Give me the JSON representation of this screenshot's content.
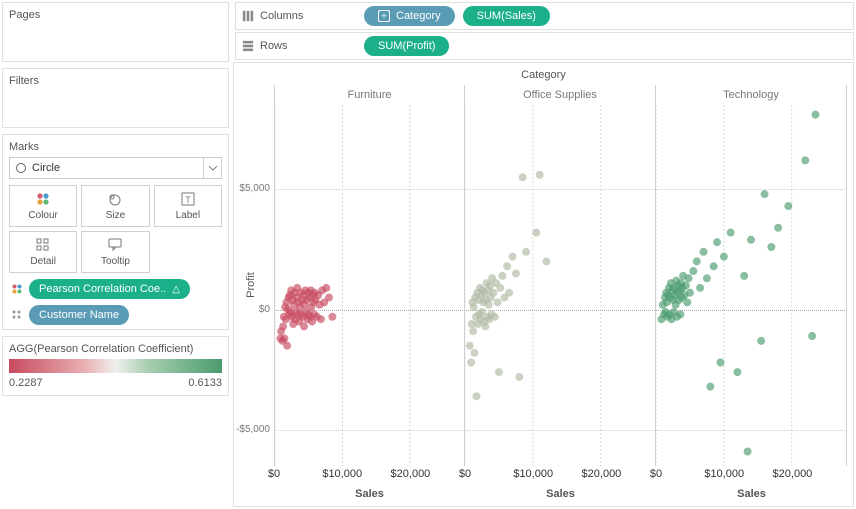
{
  "sidebar": {
    "pages_title": "Pages",
    "filters_title": "Filters",
    "marks_title": "Marks",
    "mark_type": "Circle",
    "cards": {
      "colour": "Colour",
      "size": "Size",
      "label": "Label",
      "detail": "Detail",
      "tooltip": "Tooltip"
    },
    "colour_pill": "Pearson Correlation Coe..",
    "detail_pill": "Customer Name"
  },
  "legend": {
    "title": "AGG(Pearson Correlation Coefficient)",
    "min": "0.2287",
    "max": "0.6133"
  },
  "shelves": {
    "columns_label": "Columns",
    "rows_label": "Rows",
    "columns": [
      {
        "label": "Category",
        "color": "blue",
        "plus": true
      },
      {
        "label": "SUM(Sales)",
        "color": "green",
        "plus": false
      }
    ],
    "rows": [
      {
        "label": "SUM(Profit)",
        "color": "green",
        "plus": false
      }
    ]
  },
  "chart_data": {
    "type": "scatter",
    "title": "Category",
    "xlabel": "Sales",
    "ylabel": "Profit",
    "facets": [
      "Furniture",
      "Office Supplies",
      "Technology"
    ],
    "xlim": [
      0,
      28000
    ],
    "ylim": [
      -6500,
      8500
    ],
    "xticks": [
      0,
      10000,
      20000
    ],
    "yticks": [
      -5000,
      0,
      5000
    ],
    "xtick_labels": [
      "$0",
      "$10,000",
      "$20,000"
    ],
    "ytick_labels": [
      "-$5,000",
      "$0",
      "$5,000"
    ],
    "color_field": "AGG(Pearson Correlation Coefficient)",
    "color_range": [
      0.2287,
      0.6133
    ],
    "series": [
      {
        "facet": "Furniture",
        "color_value": 0.2287,
        "points": [
          [
            800,
            -1200
          ],
          [
            900,
            -900
          ],
          [
            1100,
            -1300
          ],
          [
            1200,
            -700
          ],
          [
            1300,
            -300
          ],
          [
            1400,
            -1200
          ],
          [
            1500,
            100
          ],
          [
            1600,
            -400
          ],
          [
            1700,
            300
          ],
          [
            1800,
            -1500
          ],
          [
            1900,
            0
          ],
          [
            2000,
            500
          ],
          [
            2100,
            -200
          ],
          [
            2200,
            600
          ],
          [
            2300,
            -100
          ],
          [
            2400,
            800
          ],
          [
            2500,
            -300
          ],
          [
            2600,
            400
          ],
          [
            2700,
            -600
          ],
          [
            2800,
            200
          ],
          [
            2900,
            700
          ],
          [
            3000,
            -400
          ],
          [
            3100,
            -100
          ],
          [
            3200,
            500
          ],
          [
            3300,
            900
          ],
          [
            3400,
            -200
          ],
          [
            3500,
            300
          ],
          [
            3600,
            -500
          ],
          [
            3700,
            100
          ],
          [
            3800,
            700
          ],
          [
            3900,
            -200
          ],
          [
            4000,
            400
          ],
          [
            4100,
            -300
          ],
          [
            4200,
            600
          ],
          [
            4300,
            -700
          ],
          [
            4400,
            200
          ],
          [
            4500,
            800
          ],
          [
            4600,
            -100
          ],
          [
            4700,
            400
          ],
          [
            4800,
            -400
          ],
          [
            4900,
            700
          ],
          [
            5000,
            -200
          ],
          [
            5100,
            500
          ],
          [
            5200,
            -300
          ],
          [
            5300,
            800
          ],
          [
            5400,
            100
          ],
          [
            5500,
            -500
          ],
          [
            5600,
            600
          ],
          [
            5700,
            300
          ],
          [
            5800,
            -200
          ],
          [
            5900,
            700
          ],
          [
            6000,
            400
          ],
          [
            6200,
            -300
          ],
          [
            6400,
            600
          ],
          [
            6600,
            200
          ],
          [
            6800,
            -400
          ],
          [
            7000,
            800
          ],
          [
            7300,
            300
          ],
          [
            7600,
            900
          ],
          [
            8000,
            500
          ],
          [
            8500,
            -300
          ]
        ]
      },
      {
        "facet": "Office Supplies",
        "color_value": 0.48,
        "points": [
          [
            700,
            -1500
          ],
          [
            900,
            -2200
          ],
          [
            1000,
            -600
          ],
          [
            1100,
            300
          ],
          [
            1200,
            -900
          ],
          [
            1300,
            100
          ],
          [
            1400,
            -1800
          ],
          [
            1500,
            500
          ],
          [
            1600,
            -300
          ],
          [
            1700,
            -3600
          ],
          [
            1800,
            700
          ],
          [
            1900,
            -600
          ],
          [
            2000,
            400
          ],
          [
            2100,
            -200
          ],
          [
            2200,
            900
          ],
          [
            2300,
            -400
          ],
          [
            2400,
            600
          ],
          [
            2500,
            -100
          ],
          [
            2600,
            800
          ],
          [
            2700,
            300
          ],
          [
            2800,
            -500
          ],
          [
            2900,
            700
          ],
          [
            3000,
            -700
          ],
          [
            3100,
            400
          ],
          [
            3200,
            1100
          ],
          [
            3300,
            -300
          ],
          [
            3400,
            800
          ],
          [
            3500,
            200
          ],
          [
            3600,
            -400
          ],
          [
            3700,
            1000
          ],
          [
            3800,
            500
          ],
          [
            3900,
            -200
          ],
          [
            4000,
            1300
          ],
          [
            4200,
            700
          ],
          [
            4400,
            -300
          ],
          [
            4600,
            1100
          ],
          [
            4800,
            300
          ],
          [
            5000,
            -2600
          ],
          [
            5200,
            900
          ],
          [
            5500,
            1400
          ],
          [
            5800,
            500
          ],
          [
            6200,
            1800
          ],
          [
            6500,
            700
          ],
          [
            7000,
            2200
          ],
          [
            7500,
            1500
          ],
          [
            8000,
            -2800
          ],
          [
            8500,
            5500
          ],
          [
            9000,
            2400
          ],
          [
            10500,
            3200
          ],
          [
            11000,
            5600
          ],
          [
            12000,
            2000
          ]
        ]
      },
      {
        "facet": "Technology",
        "color_value": 0.6133,
        "points": [
          [
            800,
            -400
          ],
          [
            1000,
            200
          ],
          [
            1200,
            -200
          ],
          [
            1300,
            500
          ],
          [
            1400,
            -100
          ],
          [
            1500,
            700
          ],
          [
            1600,
            300
          ],
          [
            1700,
            -300
          ],
          [
            1800,
            600
          ],
          [
            1900,
            900
          ],
          [
            2000,
            -200
          ],
          [
            2100,
            500
          ],
          [
            2200,
            1100
          ],
          [
            2300,
            -400
          ],
          [
            2400,
            800
          ],
          [
            2500,
            400
          ],
          [
            2600,
            -100
          ],
          [
            2700,
            900
          ],
          [
            2800,
            600
          ],
          [
            2900,
            200
          ],
          [
            3000,
            1200
          ],
          [
            3100,
            -300
          ],
          [
            3200,
            700
          ],
          [
            3300,
            1000
          ],
          [
            3400,
            400
          ],
          [
            3500,
            800
          ],
          [
            3600,
            -200
          ],
          [
            3700,
            1100
          ],
          [
            3800,
            500
          ],
          [
            3900,
            900
          ],
          [
            4000,
            1400
          ],
          [
            4200,
            600
          ],
          [
            4400,
            1000
          ],
          [
            4600,
            300
          ],
          [
            4800,
            1300
          ],
          [
            5000,
            700
          ],
          [
            5500,
            1600
          ],
          [
            6000,
            2000
          ],
          [
            6500,
            900
          ],
          [
            7000,
            2400
          ],
          [
            7500,
            1300
          ],
          [
            8000,
            -3200
          ],
          [
            8500,
            1800
          ],
          [
            9000,
            2800
          ],
          [
            9500,
            -2200
          ],
          [
            10000,
            2200
          ],
          [
            11000,
            3200
          ],
          [
            12000,
            -2600
          ],
          [
            13000,
            1400
          ],
          [
            13500,
            -5900
          ],
          [
            14000,
            2900
          ],
          [
            15500,
            -1300
          ],
          [
            16000,
            4800
          ],
          [
            17000,
            2600
          ],
          [
            18000,
            3400
          ],
          [
            19500,
            4300
          ],
          [
            22000,
            6200
          ],
          [
            23500,
            8100
          ],
          [
            23000,
            -1100
          ]
        ]
      }
    ]
  }
}
